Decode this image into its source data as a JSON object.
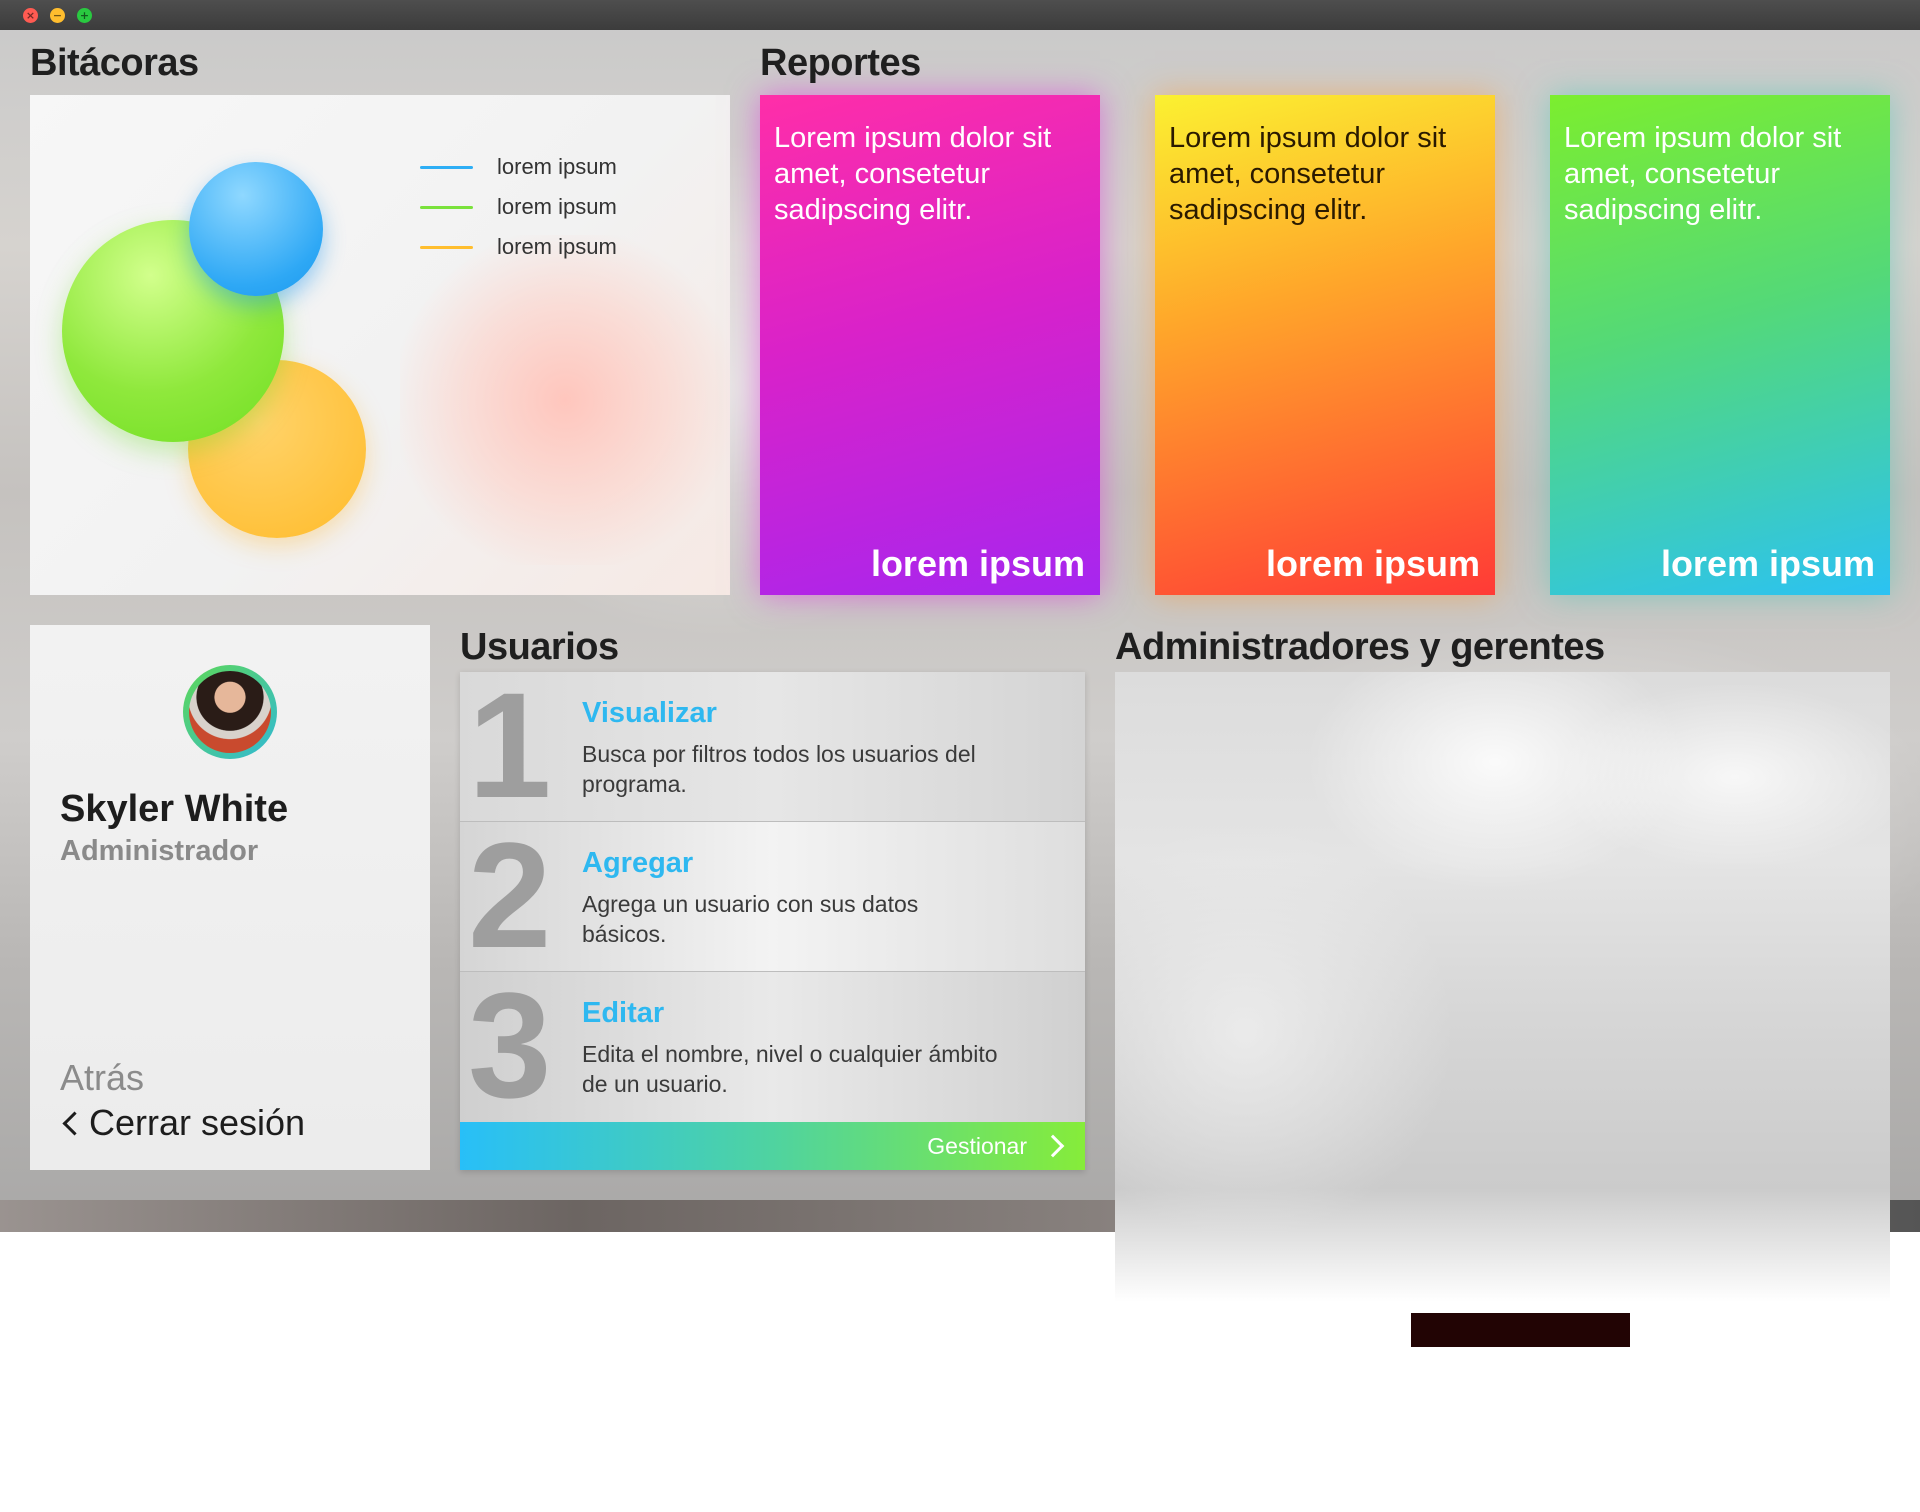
{
  "window": {
    "controls": {
      "close": "×",
      "minimize": "−",
      "maximize": "+"
    }
  },
  "bitacoras": {
    "title": "Bitácoras",
    "legend": [
      {
        "label": "lorem ipsum",
        "color": "#2eaef5"
      },
      {
        "label": "lorem ipsum",
        "color": "#7ae23c"
      },
      {
        "label": "lorem ipsum",
        "color": "#ffbe2e"
      }
    ],
    "bubble_colors": {
      "blue": "#2ea8f5",
      "green": "#8fe83c",
      "orange": "#ffbb2a"
    }
  },
  "reportes": {
    "title": "Reportes",
    "cards": [
      {
        "text": "Lorem ipsum dolor sit amet, consetetur sadipscing elitr.",
        "footer": "lorem ipsum",
        "colors": [
          "#ff2ea8",
          "#a626ef"
        ]
      },
      {
        "text": "Lorem ipsum dolor sit amet, consetetur sadipscing elitr.",
        "footer": "lorem ipsum",
        "colors": [
          "#fbf131",
          "#ff3a36"
        ]
      },
      {
        "text": "Lorem ipsum dolor sit amet, consetetur sadipscing elitr.",
        "footer": "lorem ipsum",
        "colors": [
          "#7cee2e",
          "#2bc2f3"
        ]
      }
    ]
  },
  "profile": {
    "name": "Skyler White",
    "role": "Administrador",
    "back_label": "Atrás",
    "logout_label": "Cerrar sesión"
  },
  "usuarios": {
    "title": "Usuarios",
    "items": [
      {
        "number": "1",
        "title": "Visualizar",
        "description": "Busca por filtros todos los usuarios del programa."
      },
      {
        "number": "2",
        "title": "Agregar",
        "description": "Agrega un usuario con sus datos básicos."
      },
      {
        "number": "3",
        "title": "Editar",
        "description": "Edita el nombre, nivel o cualquier ámbito de un usuario."
      }
    ],
    "action_label": "Gestionar",
    "accent": "#2eb8f0"
  },
  "administradores": {
    "title": "Administradores y gerentes"
  }
}
